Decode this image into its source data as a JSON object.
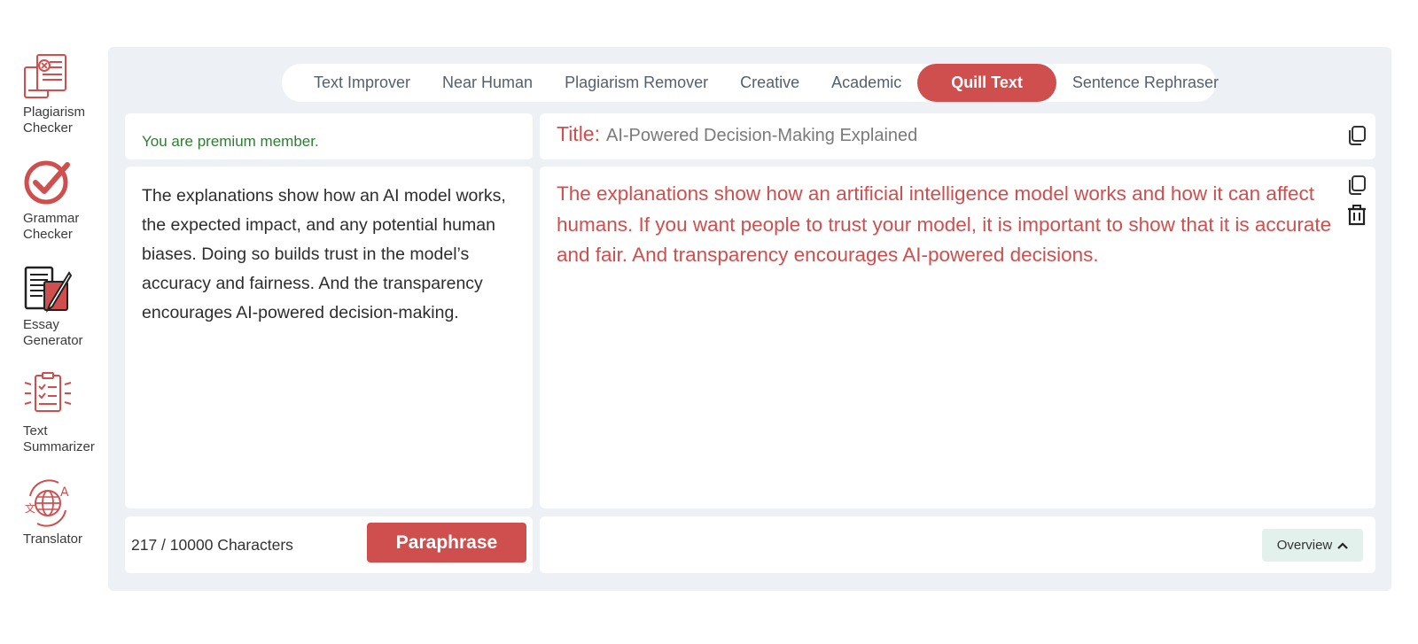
{
  "sidebar": {
    "items": [
      {
        "label_line1": "Plagiarism",
        "label_line2": "Checker",
        "icon": "plagiarism-checker-icon"
      },
      {
        "label_line1": "Grammar",
        "label_line2": "Checker",
        "icon": "grammar-checker-icon"
      },
      {
        "label_line1": "Essay",
        "label_line2": "Generator",
        "icon": "essay-generator-icon"
      },
      {
        "label_line1": "Text",
        "label_line2": "Summarizer",
        "icon": "text-summarizer-icon"
      },
      {
        "label_line1": "Translator",
        "label_line2": "",
        "icon": "translator-icon"
      }
    ]
  },
  "tabs": [
    {
      "label": "Text Improver"
    },
    {
      "label": "Near Human"
    },
    {
      "label": "Plagiarism Remover"
    },
    {
      "label": "Creative"
    },
    {
      "label": "Academic"
    },
    {
      "label": "Quill Text",
      "active": true
    },
    {
      "label": "Sentence Rephraser"
    }
  ],
  "status": {
    "premium_text": "You are premium member."
  },
  "input": {
    "text": "The explanations show how an AI model works, the expected impact, and any potential human biases. Doing so builds trust in the model’s accuracy and fairness. And the transparency encourages AI-powered decision-making."
  },
  "footer": {
    "char_count": "217 / 10000 Characters",
    "paraphrase_label": "Paraphrase"
  },
  "output": {
    "title_label": "Title:",
    "title_value": "AI-Powered Decision-Making Explained",
    "text": "The explanations show how an artificial intelligence model works and how it can affect humans. If you want people to trust your model, it is important to show that it is accurate and fair. And transparency encourages AI-powered decisions.",
    "overview_label": "Overview"
  },
  "colors": {
    "accent": "#cf4f4f",
    "panel_bg": "#edf1f6",
    "premium_green": "#2e7d32"
  }
}
